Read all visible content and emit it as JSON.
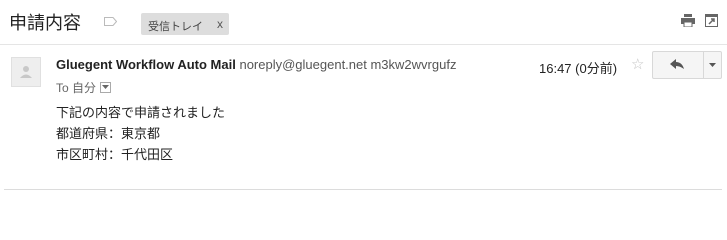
{
  "header": {
    "subject": "申請内容",
    "label_chip": "受信トレイ",
    "label_chip_close": "x"
  },
  "message": {
    "sender_name": "Gluegent Workflow Auto Mail",
    "sender_email": "noreply@gluegent.net m3kw2wvrgufz",
    "time": "16:47 (0分前)",
    "star": "☆",
    "to_label": "To 自分",
    "body_lines": [
      "下記の内容で申請されました",
      "都道府県：東京都",
      "市区町村：千代田区"
    ]
  },
  "icons": [
    "label-tag-icon",
    "print-icon",
    "new-window-icon",
    "avatar-icon",
    "star-icon",
    "reply-arrow-icon",
    "chevron-down-icon"
  ],
  "colors": {
    "chip_bg": "#dddddd",
    "star": "#c4c4c4",
    "button_bg": "#f5f5f5",
    "divider": "#e5e5e5"
  }
}
